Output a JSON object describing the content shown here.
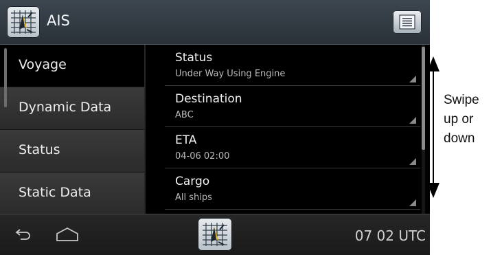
{
  "header": {
    "title": "AIS",
    "app_icon": "ais-compass-icon",
    "menu_icon": "menu-list-icon"
  },
  "nav": {
    "items": [
      {
        "label": "Voyage",
        "active": true
      },
      {
        "label": "Dynamic Data",
        "active": false
      },
      {
        "label": "Status",
        "active": false
      },
      {
        "label": "Static Data",
        "active": false
      }
    ]
  },
  "details": [
    {
      "title": "Status",
      "value": "Under Way Using Engine"
    },
    {
      "title": "Destination",
      "value": "ABC"
    },
    {
      "title": "ETA",
      "value": "04-06 02:00"
    },
    {
      "title": "Cargo",
      "value": "All ships"
    }
  ],
  "bottom_bar": {
    "back_icon": "back-arrow-icon",
    "home_icon": "home-icon",
    "time": "07 02 UTC"
  },
  "annotation": {
    "lines": [
      "Swipe",
      "up or",
      "down"
    ]
  },
  "colors": {
    "header_bg": "#353e47",
    "active_bg": "#000000",
    "nav_bg": "#2f2f2f"
  }
}
